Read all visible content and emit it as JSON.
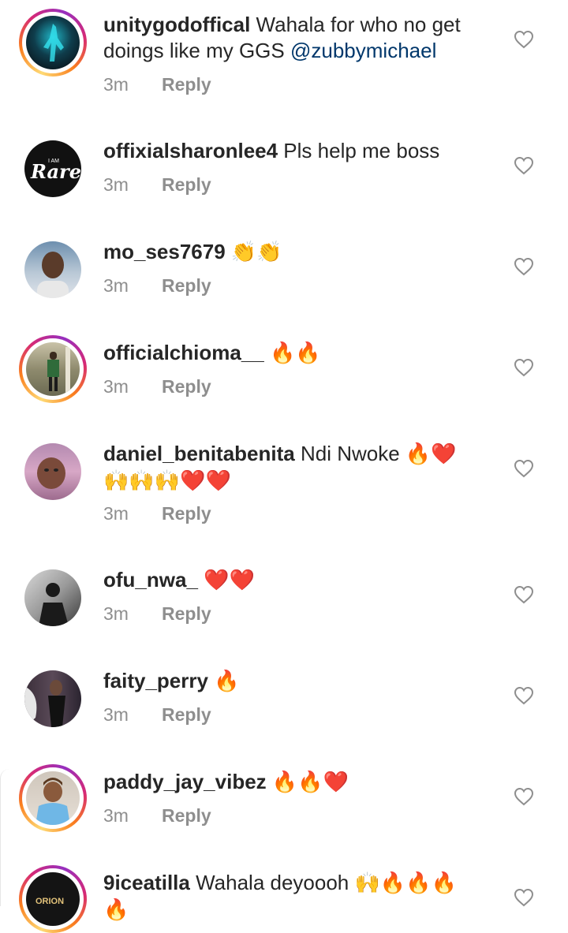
{
  "comments": [
    {
      "username": "unitygodoffical",
      "text": " Wahala for who no get doings like my GGS ",
      "mention": "@zubbymichael",
      "emojis": "",
      "time": "3m",
      "reply": "Reply",
      "story": true,
      "avatar_icon": "neon-figure-avatar"
    },
    {
      "username": "offixialsharonlee4",
      "text": " Pls help me boss",
      "mention": "",
      "emojis": "",
      "time": "3m",
      "reply": "Reply",
      "story": false,
      "avatar_icon": "i-am-rare-logo-avatar",
      "avatar_logo_small": "I AM",
      "avatar_logo_big": "Rare"
    },
    {
      "username": "mo_ses7679",
      "text": " ",
      "mention": "",
      "emojis": "👏👏",
      "time": "3m",
      "reply": "Reply",
      "story": false,
      "avatar_icon": "portrait-avatar"
    },
    {
      "username": "officialchioma__",
      "text": " ",
      "mention": "",
      "emojis": "🔥🔥",
      "time": "3m",
      "reply": "Reply",
      "story": true,
      "avatar_icon": "outdoor-photo-avatar"
    },
    {
      "username": "daniel_benitabenita",
      "text": " Ndi Nwoke ",
      "mention": "",
      "emojis": "🔥❤️ 🙌🙌🙌❤️❤️",
      "time": "3m",
      "reply": "Reply",
      "story": false,
      "avatar_icon": "selfie-avatar"
    },
    {
      "username": "ofu_nwa_",
      "text": " ",
      "mention": "",
      "emojis": "❤️❤️",
      "time": "3m",
      "reply": "Reply",
      "story": false,
      "avatar_icon": "monochrome-photo-avatar"
    },
    {
      "username": "faity_perry",
      "text": " ",
      "mention": "",
      "emojis": "🔥",
      "time": "3m",
      "reply": "Reply",
      "story": false,
      "avatar_icon": "portrait-dark-avatar"
    },
    {
      "username": "paddy_jay_vibez",
      "text": " ",
      "mention": "",
      "emojis": "🔥🔥❤️",
      "time": "3m",
      "reply": "Reply",
      "story": true,
      "avatar_icon": "cartoon-avatar"
    },
    {
      "username": "9iceatilla",
      "text": " Wahala deyoooh ",
      "mention": "",
      "emojis": "🙌🔥🔥🔥 🔥",
      "time": "",
      "reply": "",
      "story": true,
      "avatar_icon": "orion-logo-avatar",
      "avatar_logo_text": "ORION"
    }
  ],
  "colors": {
    "username": "#262626",
    "meta": "#8e8e8e",
    "mention": "#00376b"
  }
}
